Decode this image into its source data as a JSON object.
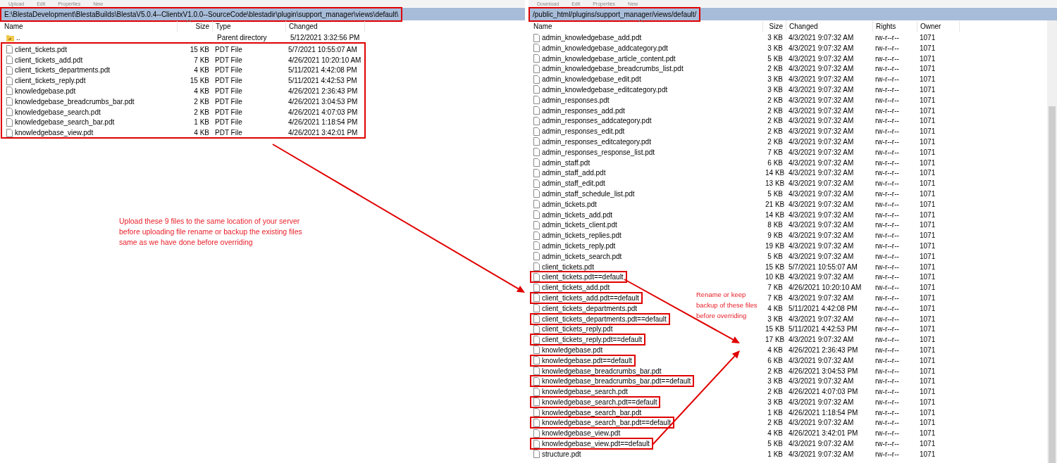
{
  "left_panel": {
    "toolbar": [
      "Upload",
      "Edit",
      "Properties",
      "New"
    ],
    "path": "E:\\BlestaDevelopment\\BlestaBuilds\\BlestaV5.0.4--ClientxV1.0.0--SourceCode\\blestadir\\plugin\\support_manager\\views\\default\\",
    "path_boxed": true,
    "columns": [
      "Name",
      "Size",
      "Type",
      "Changed"
    ],
    "parent": {
      "name": "..",
      "type": "Parent directory",
      "changed": "5/12/2021 3:32:56 PM"
    },
    "files_boxed": true,
    "files": [
      {
        "name": "client_tickets.pdt",
        "size": "15 KB",
        "type": "PDT File",
        "changed": "5/7/2021 10:55:07 AM"
      },
      {
        "name": "client_tickets_add.pdt",
        "size": "7 KB",
        "type": "PDT File",
        "changed": "4/26/2021 10:20:10 AM"
      },
      {
        "name": "client_tickets_departments.pdt",
        "size": "4 KB",
        "type": "PDT File",
        "changed": "5/11/2021 4:42:08 PM"
      },
      {
        "name": "client_tickets_reply.pdt",
        "size": "15 KB",
        "type": "PDT File",
        "changed": "5/11/2021 4:42:53 PM"
      },
      {
        "name": "knowledgebase.pdt",
        "size": "4 KB",
        "type": "PDT File",
        "changed": "4/26/2021 2:36:43 PM"
      },
      {
        "name": "knowledgebase_breadcrumbs_bar.pdt",
        "size": "2 KB",
        "type": "PDT File",
        "changed": "4/26/2021 3:04:53 PM"
      },
      {
        "name": "knowledgebase_search.pdt",
        "size": "2 KB",
        "type": "PDT File",
        "changed": "4/26/2021 4:07:03 PM"
      },
      {
        "name": "knowledgebase_search_bar.pdt",
        "size": "1 KB",
        "type": "PDT File",
        "changed": "4/26/2021 1:18:54 PM"
      },
      {
        "name": "knowledgebase_view.pdt",
        "size": "4 KB",
        "type": "PDT File",
        "changed": "4/26/2021 3:42:01 PM"
      }
    ]
  },
  "right_panel": {
    "toolbar": [
      "Download",
      "Edit",
      "Properties",
      "New"
    ],
    "path": "/public_html/plugins/support_manager/views/default/",
    "path_boxed": true,
    "columns": [
      "Name",
      "Size",
      "Changed",
      "Rights",
      "Owner"
    ],
    "files": [
      {
        "name": "admin_knowledgebase_add.pdt",
        "size": "3 KB",
        "changed": "4/3/2021 9:07:32 AM",
        "rights": "rw-r--r--",
        "owner": "1071",
        "boxed": false
      },
      {
        "name": "admin_knowledgebase_addcategory.pdt",
        "size": "3 KB",
        "changed": "4/3/2021 9:07:32 AM",
        "rights": "rw-r--r--",
        "owner": "1071",
        "boxed": false
      },
      {
        "name": "admin_knowledgebase_article_content.pdt",
        "size": "5 KB",
        "changed": "4/3/2021 9:07:32 AM",
        "rights": "rw-r--r--",
        "owner": "1071",
        "boxed": false
      },
      {
        "name": "admin_knowledgebase_breadcrumbs_list.pdt",
        "size": "2 KB",
        "changed": "4/3/2021 9:07:32 AM",
        "rights": "rw-r--r--",
        "owner": "1071",
        "boxed": false
      },
      {
        "name": "admin_knowledgebase_edit.pdt",
        "size": "3 KB",
        "changed": "4/3/2021 9:07:32 AM",
        "rights": "rw-r--r--",
        "owner": "1071",
        "boxed": false
      },
      {
        "name": "admin_knowledgebase_editcategory.pdt",
        "size": "3 KB",
        "changed": "4/3/2021 9:07:32 AM",
        "rights": "rw-r--r--",
        "owner": "1071",
        "boxed": false
      },
      {
        "name": "admin_responses.pdt",
        "size": "2 KB",
        "changed": "4/3/2021 9:07:32 AM",
        "rights": "rw-r--r--",
        "owner": "1071",
        "boxed": false
      },
      {
        "name": "admin_responses_add.pdt",
        "size": "2 KB",
        "changed": "4/3/2021 9:07:32 AM",
        "rights": "rw-r--r--",
        "owner": "1071",
        "boxed": false
      },
      {
        "name": "admin_responses_addcategory.pdt",
        "size": "2 KB",
        "changed": "4/3/2021 9:07:32 AM",
        "rights": "rw-r--r--",
        "owner": "1071",
        "boxed": false
      },
      {
        "name": "admin_responses_edit.pdt",
        "size": "2 KB",
        "changed": "4/3/2021 9:07:32 AM",
        "rights": "rw-r--r--",
        "owner": "1071",
        "boxed": false
      },
      {
        "name": "admin_responses_editcategory.pdt",
        "size": "2 KB",
        "changed": "4/3/2021 9:07:32 AM",
        "rights": "rw-r--r--",
        "owner": "1071",
        "boxed": false
      },
      {
        "name": "admin_responses_response_list.pdt",
        "size": "7 KB",
        "changed": "4/3/2021 9:07:32 AM",
        "rights": "rw-r--r--",
        "owner": "1071",
        "boxed": false
      },
      {
        "name": "admin_staff.pdt",
        "size": "6 KB",
        "changed": "4/3/2021 9:07:32 AM",
        "rights": "rw-r--r--",
        "owner": "1071",
        "boxed": false
      },
      {
        "name": "admin_staff_add.pdt",
        "size": "14 KB",
        "changed": "4/3/2021 9:07:32 AM",
        "rights": "rw-r--r--",
        "owner": "1071",
        "boxed": false
      },
      {
        "name": "admin_staff_edit.pdt",
        "size": "13 KB",
        "changed": "4/3/2021 9:07:32 AM",
        "rights": "rw-r--r--",
        "owner": "1071",
        "boxed": false
      },
      {
        "name": "admin_staff_schedule_list.pdt",
        "size": "5 KB",
        "changed": "4/3/2021 9:07:32 AM",
        "rights": "rw-r--r--",
        "owner": "1071",
        "boxed": false
      },
      {
        "name": "admin_tickets.pdt",
        "size": "21 KB",
        "changed": "4/3/2021 9:07:32 AM",
        "rights": "rw-r--r--",
        "owner": "1071",
        "boxed": false
      },
      {
        "name": "admin_tickets_add.pdt",
        "size": "14 KB",
        "changed": "4/3/2021 9:07:32 AM",
        "rights": "rw-r--r--",
        "owner": "1071",
        "boxed": false
      },
      {
        "name": "admin_tickets_client.pdt",
        "size": "8 KB",
        "changed": "4/3/2021 9:07:32 AM",
        "rights": "rw-r--r--",
        "owner": "1071",
        "boxed": false
      },
      {
        "name": "admin_tickets_replies.pdt",
        "size": "9 KB",
        "changed": "4/3/2021 9:07:32 AM",
        "rights": "rw-r--r--",
        "owner": "1071",
        "boxed": false
      },
      {
        "name": "admin_tickets_reply.pdt",
        "size": "19 KB",
        "changed": "4/3/2021 9:07:32 AM",
        "rights": "rw-r--r--",
        "owner": "1071",
        "boxed": false
      },
      {
        "name": "admin_tickets_search.pdt",
        "size": "5 KB",
        "changed": "4/3/2021 9:07:32 AM",
        "rights": "rw-r--r--",
        "owner": "1071",
        "boxed": false
      },
      {
        "name": "client_tickets.pdt",
        "size": "15 KB",
        "changed": "5/7/2021 10:55:07 AM",
        "rights": "rw-r--r--",
        "owner": "1071",
        "boxed": false
      },
      {
        "name": "client_tickets.pdt==default",
        "size": "10 KB",
        "changed": "4/3/2021 9:07:32 AM",
        "rights": "rw-r--r--",
        "owner": "1071",
        "boxed": true
      },
      {
        "name": "client_tickets_add.pdt",
        "size": "7 KB",
        "changed": "4/26/2021 10:20:10 AM",
        "rights": "rw-r--r--",
        "owner": "1071",
        "boxed": false
      },
      {
        "name": "client_tickets_add.pdt==default",
        "size": "7 KB",
        "changed": "4/3/2021 9:07:32 AM",
        "rights": "rw-r--r--",
        "owner": "1071",
        "boxed": true
      },
      {
        "name": "client_tickets_departments.pdt",
        "size": "4 KB",
        "changed": "5/11/2021 4:42:08 PM",
        "rights": "rw-r--r--",
        "owner": "1071",
        "boxed": false
      },
      {
        "name": "client_tickets_departments.pdt==default",
        "size": "3 KB",
        "changed": "4/3/2021 9:07:32 AM",
        "rights": "rw-r--r--",
        "owner": "1071",
        "boxed": true
      },
      {
        "name": "client_tickets_reply.pdt",
        "size": "15 KB",
        "changed": "5/11/2021 4:42:53 PM",
        "rights": "rw-r--r--",
        "owner": "1071",
        "boxed": false
      },
      {
        "name": "client_tickets_reply.pdt==default",
        "size": "17 KB",
        "changed": "4/3/2021 9:07:32 AM",
        "rights": "rw-r--r--",
        "owner": "1071",
        "boxed": true
      },
      {
        "name": "knowledgebase.pdt",
        "size": "4 KB",
        "changed": "4/26/2021 2:36:43 PM",
        "rights": "rw-r--r--",
        "owner": "1071",
        "boxed": false
      },
      {
        "name": "knowledgebase.pdt==default",
        "size": "6 KB",
        "changed": "4/3/2021 9:07:32 AM",
        "rights": "rw-r--r--",
        "owner": "1071",
        "boxed": true
      },
      {
        "name": "knowledgebase_breadcrumbs_bar.pdt",
        "size": "2 KB",
        "changed": "4/26/2021 3:04:53 PM",
        "rights": "rw-r--r--",
        "owner": "1071",
        "boxed": false
      },
      {
        "name": "knowledgebase_breadcrumbs_bar.pdt==default",
        "size": "3 KB",
        "changed": "4/3/2021 9:07:32 AM",
        "rights": "rw-r--r--",
        "owner": "1071",
        "boxed": true
      },
      {
        "name": "knowledgebase_search.pdt",
        "size": "2 KB",
        "changed": "4/26/2021 4:07:03 PM",
        "rights": "rw-r--r--",
        "owner": "1071",
        "boxed": false
      },
      {
        "name": "knowledgebase_search.pdt==default",
        "size": "3 KB",
        "changed": "4/3/2021 9:07:32 AM",
        "rights": "rw-r--r--",
        "owner": "1071",
        "boxed": true
      },
      {
        "name": "knowledgebase_search_bar.pdt",
        "size": "1 KB",
        "changed": "4/26/2021 1:18:54 PM",
        "rights": "rw-r--r--",
        "owner": "1071",
        "boxed": false
      },
      {
        "name": "knowledgebase_search_bar.pdt==default",
        "size": "2 KB",
        "changed": "4/3/2021 9:07:32 AM",
        "rights": "rw-r--r--",
        "owner": "1071",
        "boxed": true
      },
      {
        "name": "knowledgebase_view.pdt",
        "size": "4 KB",
        "changed": "4/26/2021 3:42:01 PM",
        "rights": "rw-r--r--",
        "owner": "1071",
        "boxed": false
      },
      {
        "name": "knowledgebase_view.pdt==default",
        "size": "5 KB",
        "changed": "4/3/2021 9:07:32 AM",
        "rights": "rw-r--r--",
        "owner": "1071",
        "boxed": true
      },
      {
        "name": "structure.pdt",
        "size": "1 KB",
        "changed": "4/3/2021 9:07:32 AM",
        "rights": "rw-r--r--",
        "owner": "1071",
        "boxed": false
      }
    ]
  },
  "annotations": [
    "Upload these 9 files to the same location of your server\nbefore uploading file rename or backup the existing files\nsame as we have done before overriding",
    "Rename or keep\nbackup of these files\nbefore overriding"
  ]
}
